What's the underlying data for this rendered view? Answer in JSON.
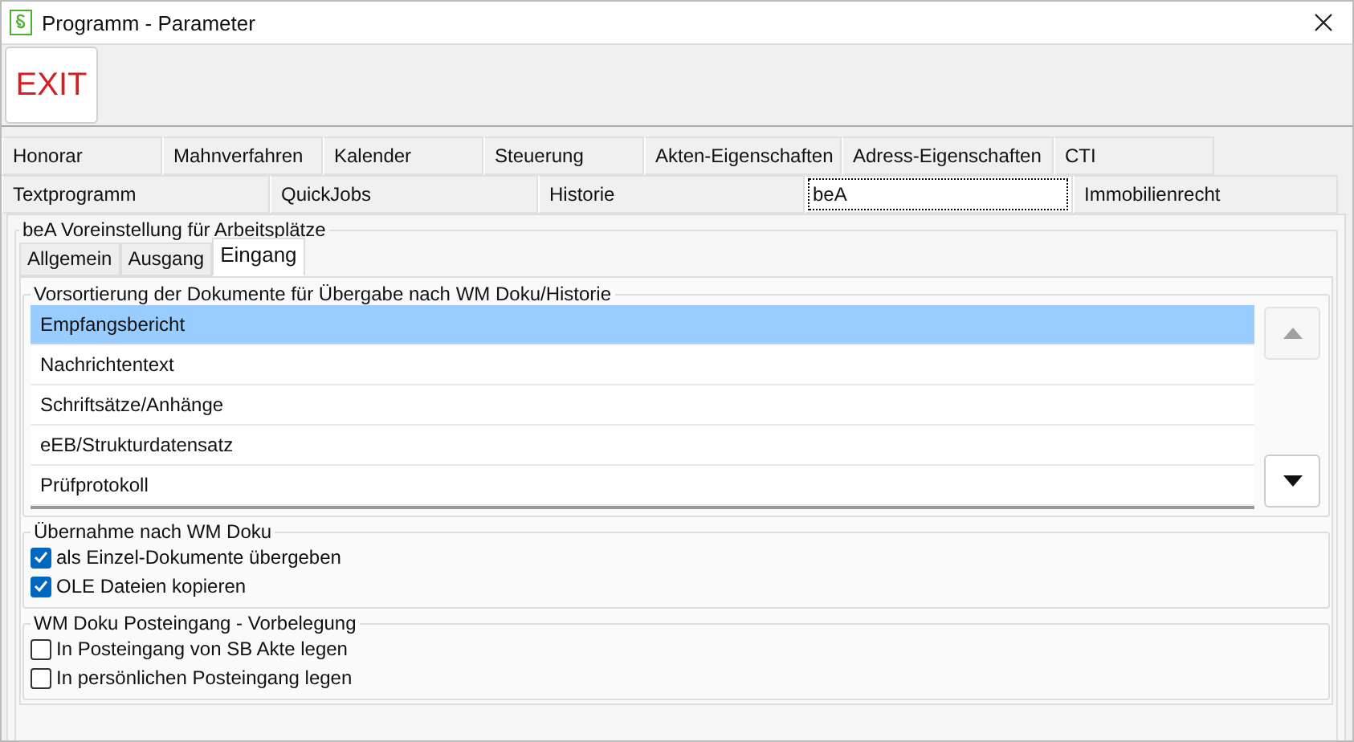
{
  "window": {
    "title": "Programm - Parameter"
  },
  "toolbar": {
    "exit_button": "EXIT"
  },
  "tabs_row_1": [
    {
      "label": "Honorar",
      "selected": false
    },
    {
      "label": "Mahnverfahren",
      "selected": false
    },
    {
      "label": "Kalender",
      "selected": false
    },
    {
      "label": "Steuerung",
      "selected": false
    },
    {
      "label": "Akten-Eigenschaften",
      "selected": false
    },
    {
      "label": "Adress-Eigenschaften",
      "selected": false
    },
    {
      "label": "CTI",
      "selected": false
    }
  ],
  "tabs_row_2": [
    {
      "label": "Textprogramm",
      "selected": false
    },
    {
      "label": "QuickJobs",
      "selected": false
    },
    {
      "label": "Historie",
      "selected": false
    },
    {
      "label": "beA",
      "selected": true
    },
    {
      "label": "Immobilienrecht",
      "selected": false
    }
  ],
  "group": {
    "title": "beA Voreinstellung für Arbeitsplätze",
    "tabs": [
      {
        "label": "Allgemein",
        "selected": false
      },
      {
        "label": "Ausgang",
        "selected": false
      },
      {
        "label": "Eingang",
        "selected": true
      }
    ],
    "sorting": {
      "title": "Vorsortierung der Dokumente für Übergabe nach WM Doku/Historie",
      "items": [
        {
          "label": "Empfangsbericht",
          "selected": true
        },
        {
          "label": "Nachrichtentext",
          "selected": false
        },
        {
          "label": "Schriftsätze/Anhänge",
          "selected": false
        },
        {
          "label": "eEB/Strukturdatensatz",
          "selected": false
        },
        {
          "label": "Prüfprotokoll",
          "selected": false
        }
      ],
      "move_up": {
        "disabled": true
      },
      "move_down": {
        "disabled": false
      }
    },
    "options": [
      {
        "title": "Übernahme nach WM Doku",
        "checkboxes": [
          {
            "label": "als Einzel-Dokumente übergeben",
            "checked": true
          },
          {
            "label": "OLE Dateien kopieren",
            "checked": true
          }
        ]
      },
      {
        "title": "WM Doku Posteingang - Vorbelegung",
        "checkboxes": [
          {
            "label": "In Posteingang von SB Akte legen",
            "checked": false
          },
          {
            "label": "In persönlichen Posteingang legen",
            "checked": false
          }
        ]
      }
    ]
  }
}
